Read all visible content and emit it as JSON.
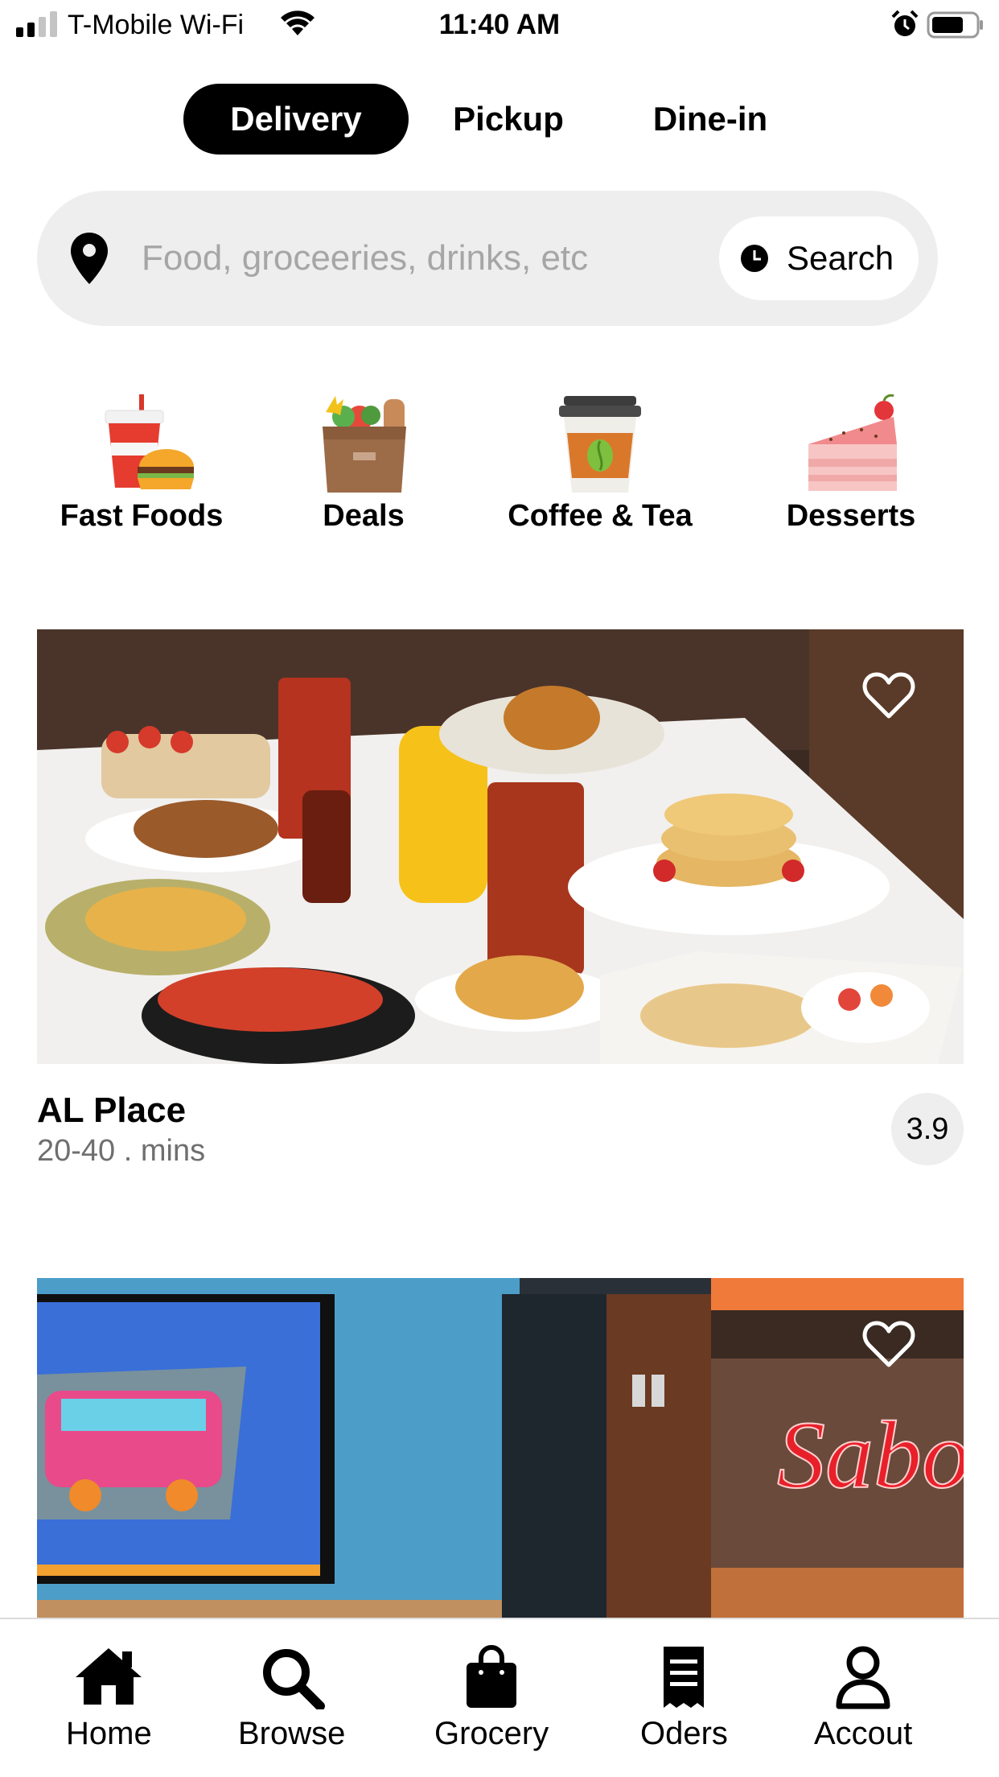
{
  "status_bar": {
    "carrier": "T-Mobile Wi-Fi",
    "time": "11:40 AM",
    "icons": [
      "signal-icon",
      "wifi-icon",
      "alarm-icon",
      "battery-icon"
    ]
  },
  "mode_tabs": {
    "items": [
      {
        "label": "Delivery",
        "active": true
      },
      {
        "label": "Pickup",
        "active": false
      },
      {
        "label": "Dine-in",
        "active": false
      }
    ]
  },
  "search": {
    "placeholder": "Food, groceeries, drinks, etc",
    "value": "",
    "button_label": "Search",
    "icons": [
      "location-pin-icon",
      "clock-icon"
    ]
  },
  "categories": [
    {
      "label": "Fast Foods",
      "icon": "fast-food-icon"
    },
    {
      "label": "Deals",
      "icon": "grocery-bag-icon"
    },
    {
      "label": "Coffee & Tea",
      "icon": "coffee-cup-icon"
    },
    {
      "label": "Desserts",
      "icon": "cake-slice-icon"
    }
  ],
  "restaurants": [
    {
      "name": "AL Place",
      "time": "20-40 . mins",
      "rating": "3.9",
      "favorite_icon": "heart-outline-icon"
    },
    {
      "sign_text": "Sabor",
      "favorite_icon": "heart-outline-icon"
    }
  ],
  "bottom_nav": {
    "items": [
      {
        "label": "Home",
        "icon": "home-icon"
      },
      {
        "label": "Browse",
        "icon": "search-icon"
      },
      {
        "label": "Grocery",
        "icon": "shopping-bag-icon"
      },
      {
        "label": "Oders",
        "icon": "receipt-icon"
      },
      {
        "label": "Accout",
        "icon": "user-icon"
      }
    ]
  },
  "colors": {
    "accent": "#000000",
    "surface": "#eeeeee",
    "muted_text": "#6f6f6f",
    "placeholder": "#a6a6a6"
  }
}
